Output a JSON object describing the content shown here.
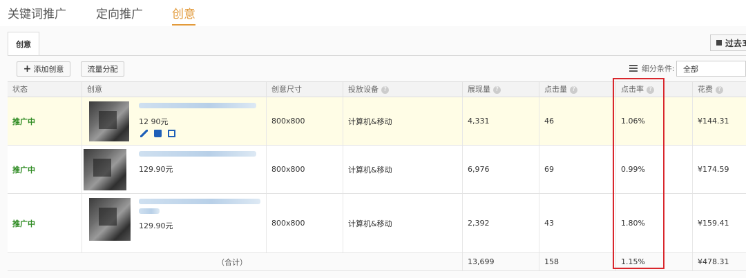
{
  "nav": {
    "tabs": [
      {
        "label": "关键词推广"
      },
      {
        "label": "定向推广"
      },
      {
        "label": "创意"
      }
    ]
  },
  "subtab": {
    "label": "创意"
  },
  "range_button": {
    "label": "过去3"
  },
  "toolbar": {
    "add_label": "添加创意",
    "traffic_label": "流量分配",
    "filter_label": "细分条件:",
    "filter_value": "全部"
  },
  "table": {
    "headers": {
      "status": "状态",
      "creative": "创意",
      "size": "创意尺寸",
      "device": "投放设备",
      "impressions": "展现量",
      "clicks": "点击量",
      "ctr": "点击率",
      "cost": "花费"
    },
    "rows": [
      {
        "status": "推广中",
        "price": "12  90元",
        "size": "800x800",
        "device": "计算机&移动",
        "impressions": "4,331",
        "clicks": "46",
        "ctr": "1.06%",
        "cost": "¥144.31"
      },
      {
        "status": "推广中",
        "price": "129.90元",
        "size": "800x800",
        "device": "计算机&移动",
        "impressions": "6,976",
        "clicks": "69",
        "ctr": "0.99%",
        "cost": "¥174.59"
      },
      {
        "status": "推广中",
        "price": "129.90元",
        "size": "800x800",
        "device": "计算机&移动",
        "impressions": "2,392",
        "clicks": "43",
        "ctr": "1.80%",
        "cost": "¥159.41"
      }
    ],
    "total": {
      "label": "（合计）",
      "impressions": "13,699",
      "clicks": "158",
      "ctr": "1.15%",
      "cost": "¥478.31"
    }
  }
}
